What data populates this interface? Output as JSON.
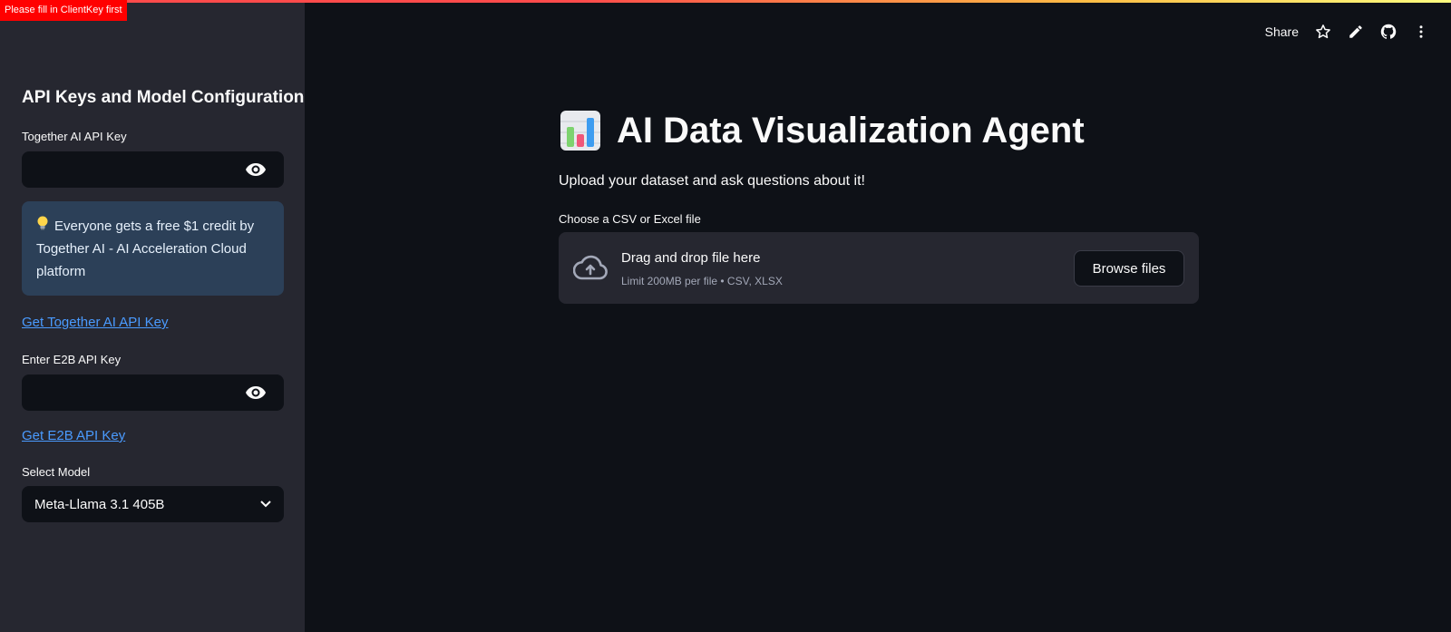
{
  "error_badge": "Please fill in ClientKey first",
  "sidebar": {
    "title": "API Keys and Model Configuration",
    "together_label": "Together AI API Key",
    "together_value": "",
    "info_text": "Everyone gets a free $1 credit by Together AI - AI Acceleration Cloud platform",
    "info_icon": "lightbulb-icon",
    "together_link": "Get Together AI API Key",
    "e2b_label": "Enter E2B API Key",
    "e2b_value": "",
    "e2b_link": "Get E2B API Key",
    "model_label": "Select Model",
    "model_value": "Meta-Llama 3.1 405B"
  },
  "header": {
    "share_label": "Share",
    "icons": [
      "star-icon",
      "pencil-icon",
      "github-icon",
      "more-vertical-icon"
    ]
  },
  "main": {
    "title": "AI Data Visualization Agent",
    "title_icon": "bar-chart-icon",
    "subtitle": "Upload your dataset and ask questions about it!",
    "upload_label": "Choose a CSV or Excel file",
    "dropzone_title": "Drag and drop file here",
    "dropzone_hint": "Limit 200MB per file • CSV, XLSX",
    "browse_label": "Browse files"
  },
  "colors": {
    "background": "#0e1117",
    "sidebar": "#262730",
    "info_box": "#2c4058",
    "link": "#4a9bff",
    "error": "#ff0000"
  }
}
